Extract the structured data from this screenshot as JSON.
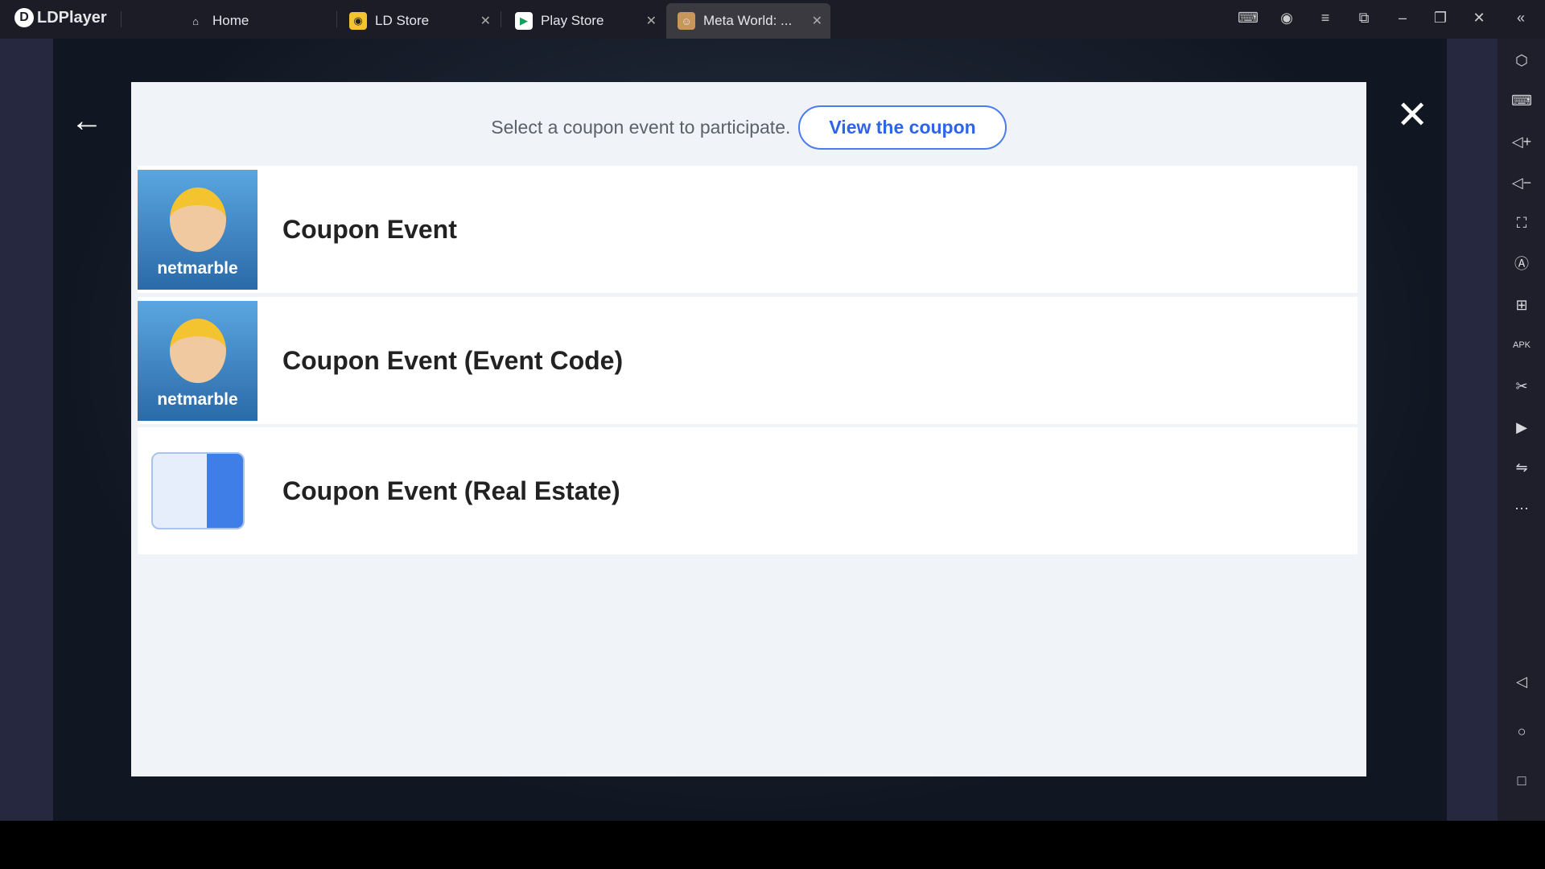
{
  "app": {
    "name": "LDPlayer"
  },
  "tabs": [
    {
      "label": "Home",
      "icon": "home-icon"
    },
    {
      "label": "LD Store",
      "icon": "ld-store-icon",
      "closable": true
    },
    {
      "label": "Play Store",
      "icon": "play-store-icon",
      "closable": true
    },
    {
      "label": "Meta World: ...",
      "icon": "game-icon",
      "closable": true,
      "active": true
    }
  ],
  "dialog": {
    "prompt": "Select a coupon event to participate.",
    "view_button": "View the coupon",
    "events": [
      {
        "label": "Coupon Event",
        "image_brand": "netmarble"
      },
      {
        "label": "Coupon Event (Event Code)",
        "image_brand": "netmarble"
      },
      {
        "label": "Coupon Event (Real Estate)",
        "image": "real-estate-ticket"
      }
    ]
  },
  "colors": {
    "accent": "#2e64e6",
    "modal_bg": "#f0f3f7",
    "topbar": "#1b1c26"
  }
}
